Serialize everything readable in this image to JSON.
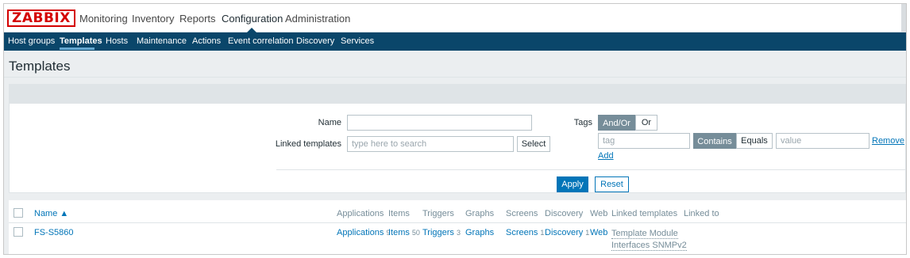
{
  "logo": "ZABBIX",
  "top_menu": [
    "Monitoring",
    "Inventory",
    "Reports",
    "Configuration",
    "Administration"
  ],
  "active_top_menu": "Configuration",
  "sub_menu": [
    "Host groups",
    "Templates",
    "Hosts",
    "Maintenance",
    "Actions",
    "Event correlation",
    "Discovery",
    "Services"
  ],
  "active_sub_menu": "Templates",
  "page_title": "Templates",
  "filter": {
    "name_label": "Name",
    "name_value": "",
    "linked_label": "Linked templates",
    "linked_placeholder": "type here to search",
    "select_label": "Select",
    "tags_label": "Tags",
    "and_or": "And/Or",
    "or": "Or",
    "tag_placeholder": "tag",
    "contains": "Contains",
    "equals": "Equals",
    "value_placeholder": "value",
    "remove": "Remove",
    "add": "Add",
    "apply": "Apply",
    "reset": "Reset"
  },
  "table": {
    "columns": [
      "Name ▲",
      "Applications",
      "Items",
      "Triggers",
      "Graphs",
      "Screens",
      "Discovery",
      "Web",
      "Linked templates",
      "Linked to"
    ],
    "rows": [
      {
        "name": "FS-S5860",
        "applications": "Applications",
        "applications_count": "9",
        "items": "Items",
        "items_count": "50",
        "triggers": "Triggers",
        "triggers_count": "3",
        "graphs": "Graphs",
        "screens": "Screens",
        "screens_count": "1",
        "discovery": "Discovery",
        "discovery_count": "1",
        "web": "Web",
        "linked_templates_line1": "Template Module",
        "linked_templates_line2": "Interfaces SNMPv2",
        "linked_to": ""
      }
    ]
  },
  "colors": {
    "brand_red": "#d40000",
    "subnav_bg": "#0a466a",
    "link": "#0275b8",
    "segment_active": "#768d99"
  }
}
